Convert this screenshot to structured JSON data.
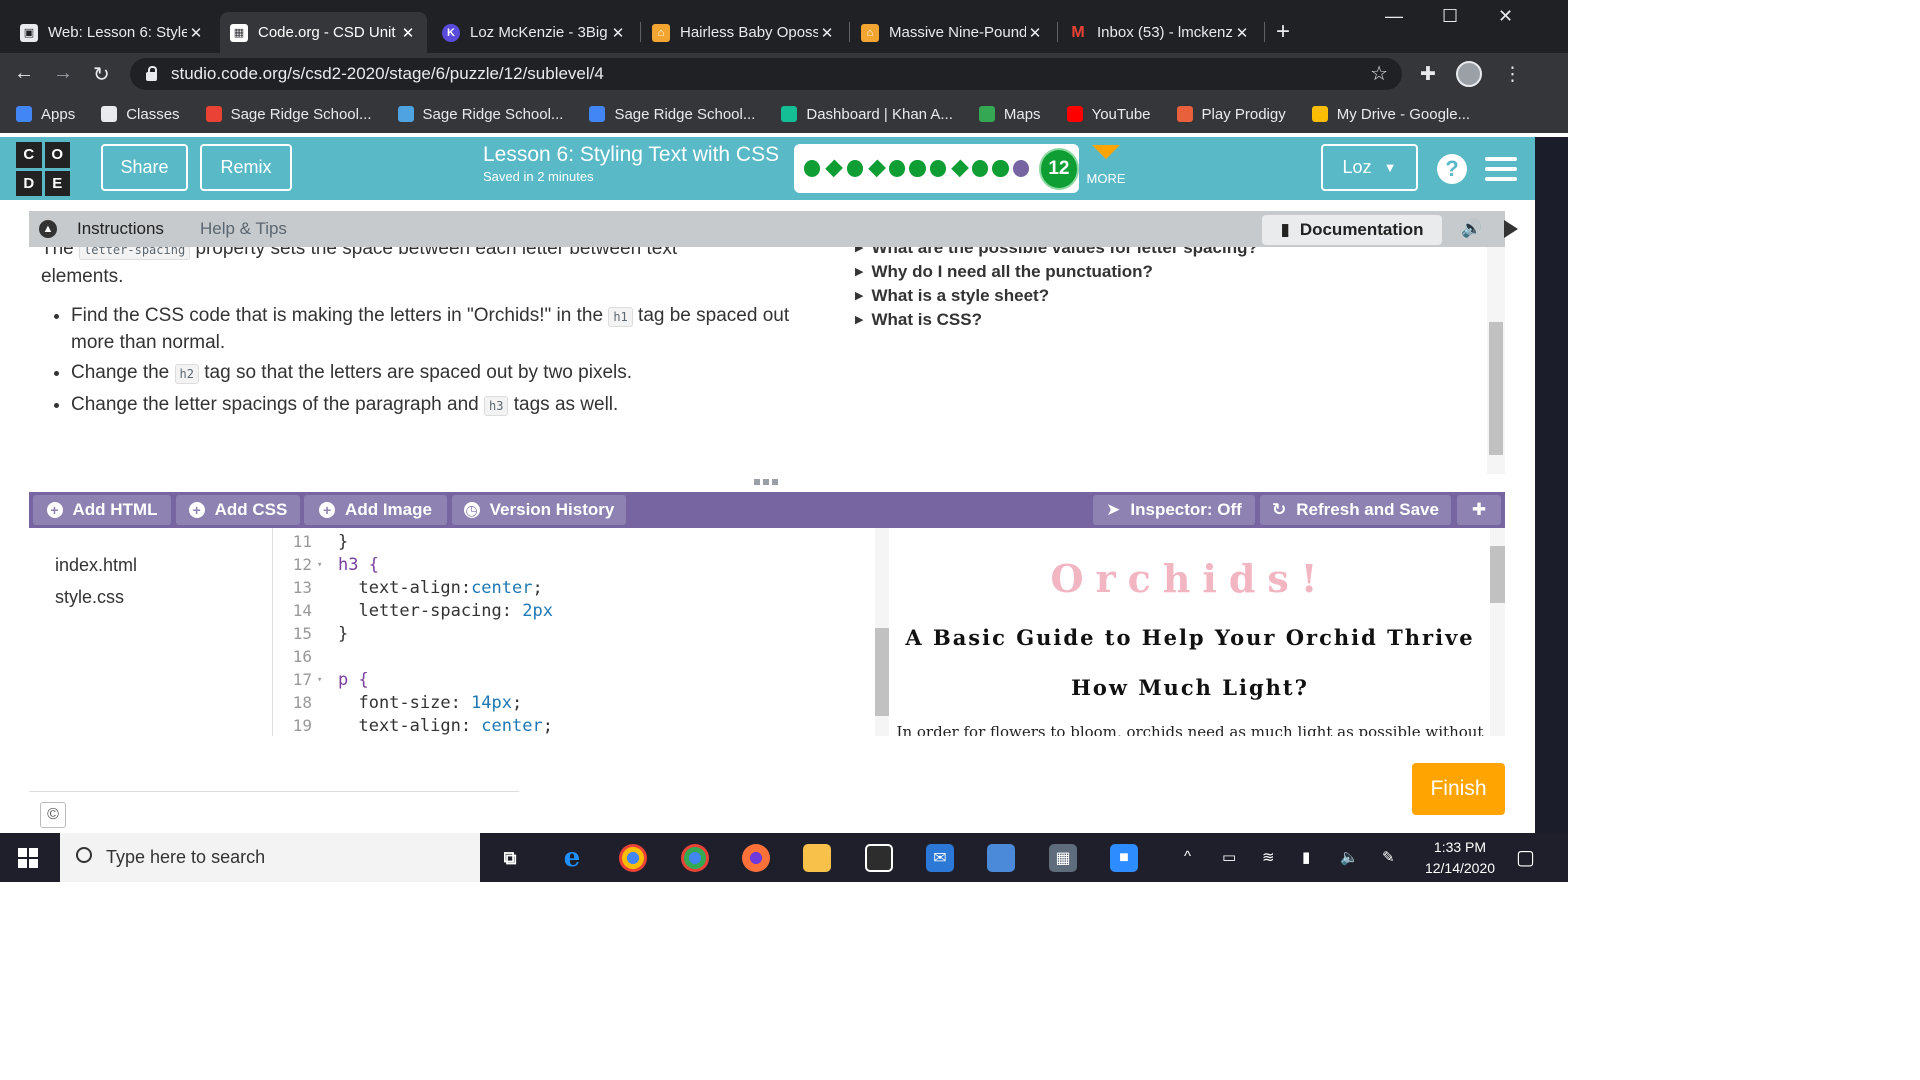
{
  "browser": {
    "tabs": [
      {
        "title": "Web: Lesson 6: Style",
        "active": false,
        "icon": "page-icon"
      },
      {
        "title": "Code.org - CSD Unit",
        "active": true,
        "icon": "codeorg-icon"
      },
      {
        "title": "Loz McKenzie - 3Big",
        "active": false,
        "icon": "k-icon"
      },
      {
        "title": "Hairless Baby Opossu",
        "active": false,
        "icon": "house-icon"
      },
      {
        "title": "Massive Nine-Pound",
        "active": false,
        "icon": "house-icon"
      },
      {
        "title": "Inbox (53) - lmckenz",
        "active": false,
        "icon": "gmail-icon"
      }
    ],
    "close_glyph": "✕",
    "new_tab_glyph": "+",
    "window_controls": {
      "minimize": "—",
      "maximize": "☐",
      "close": "✕"
    },
    "url": "studio.code.org/s/csd2-2020/stage/6/puzzle/12/sublevel/4",
    "nav": {
      "back": "←",
      "forward": "→",
      "reload": "↻",
      "star": "☆",
      "extensions": "✚",
      "menu": "⋮"
    },
    "bookmarks": [
      {
        "label": "Apps",
        "icon": "apps-grid-icon",
        "color": "#4285f4"
      },
      {
        "label": "Classes",
        "icon": "classes-icon",
        "color": "#e8eaed"
      },
      {
        "label": "Sage Ridge School...",
        "icon": "gmail-icon",
        "color": "#ea4335"
      },
      {
        "label": "Sage Ridge School...",
        "icon": "mortarboard-icon",
        "color": "#4fa3e0"
      },
      {
        "label": "Sage Ridge School...",
        "icon": "calendar-icon",
        "color": "#4285f4"
      },
      {
        "label": "Dashboard | Khan A...",
        "icon": "khan-icon",
        "color": "#14bf96"
      },
      {
        "label": "Maps",
        "icon": "maps-pin-icon",
        "color": "#34a853"
      },
      {
        "label": "YouTube",
        "icon": "youtube-icon",
        "color": "#ff0000"
      },
      {
        "label": "Play Prodigy",
        "icon": "prodigy-icon",
        "color": "#e8603c"
      },
      {
        "label": "My Drive - Google...",
        "icon": "drive-icon",
        "color": "#fbbc04"
      }
    ]
  },
  "header": {
    "logo_letters": [
      "C",
      "O",
      "D",
      "E"
    ],
    "share_label": "Share",
    "remix_label": "Remix",
    "lesson_title": "Lesson 6: Styling Text with CSS",
    "saved_text": "Saved in 2 minutes",
    "progress": {
      "markers": [
        "dot",
        "diamond",
        "dot",
        "diamond",
        "dot",
        "dot",
        "dot",
        "diamond",
        "dot",
        "dot",
        "current-dot"
      ],
      "current_level": "12",
      "complete_color": "#0e9e33",
      "current_color": "#7665a0"
    },
    "more_label": "MORE",
    "user_label": "Loz",
    "help_label": "?",
    "accent_color": "#59b9c7"
  },
  "instructions": {
    "tabs": {
      "instructions": "Instructions",
      "help_tips": "Help & Tips"
    },
    "documentation_label": "Documentation",
    "intro_prefix": "The",
    "intro_code": "letter-spacing",
    "intro_suffix": "property sets the space between each letter between text",
    "intro_end": "elements.",
    "bullets": [
      {
        "before": "Find the CSS code that is making the letters in \"Orchids!\" in the",
        "code": "h1",
        "after": "tag be spaced out more than normal."
      },
      {
        "before": "Change the",
        "code": "h2",
        "after": "tag so that the letters are spaced out by two pixels."
      },
      {
        "before": "Change the letter spacings of the paragraph and",
        "code": "h3",
        "after": "tags as well."
      }
    ],
    "hints": [
      "What are the possible values for letter spacing?",
      "Why do I need all the punctuation?",
      "What is a style sheet?",
      "What is CSS?"
    ]
  },
  "toolbar": {
    "add_html": "Add HTML",
    "add_css": "Add CSS",
    "add_image": "Add Image",
    "version_history": "Version History",
    "inspector": "Inspector: Off",
    "refresh_save": "Refresh and Save"
  },
  "files": [
    "index.html",
    "style.css"
  ],
  "editor": {
    "lines": [
      {
        "num": "11",
        "fold": "",
        "text": "}"
      },
      {
        "num": "12",
        "fold": "▾",
        "text": "h3 {"
      },
      {
        "num": "13",
        "fold": "",
        "prop": "  text-align:",
        "value": "center",
        "end": ";"
      },
      {
        "num": "14",
        "fold": "",
        "prop": "  letter-spacing: ",
        "value": "2px",
        "end": ""
      },
      {
        "num": "15",
        "fold": "",
        "text": "}"
      },
      {
        "num": "16",
        "fold": "",
        "text": ""
      },
      {
        "num": "17",
        "fold": "▾",
        "text": "p {"
      },
      {
        "num": "18",
        "fold": "",
        "prop": "  font-size: ",
        "value": "14px",
        "end": ";"
      },
      {
        "num": "19",
        "fold": "",
        "prop": "  text-align: ",
        "value": "center",
        "end": ";"
      }
    ]
  },
  "preview": {
    "h1": "Orchids!",
    "h2": "A Basic Guide to Help Your Orchid Thrive",
    "h3": "How Much Light?",
    "p": "In order for flowers to bloom, orchids need as much light as possible without"
  },
  "finish_label": "Finish",
  "copyright_glyph": "©",
  "taskbar": {
    "search_placeholder": "Type here to search",
    "time": "1:33 PM",
    "date": "12/14/2020"
  }
}
